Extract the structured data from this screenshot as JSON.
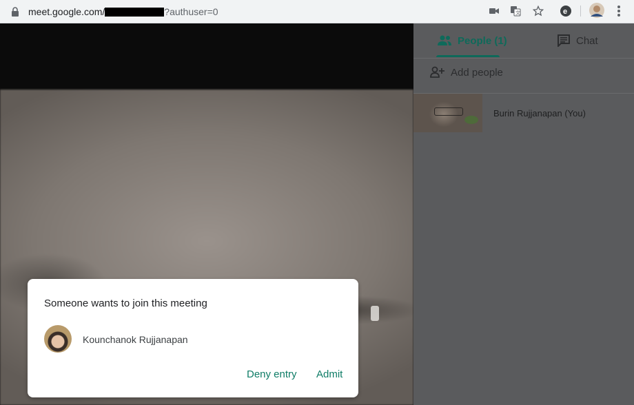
{
  "browser": {
    "url_domain": "meet.google.com/",
    "url_suffix": "?authuser=0",
    "icons": [
      "lock-icon",
      "video-camera-icon",
      "translate-icon",
      "star-icon",
      "extension-icon",
      "profile-avatar",
      "menu-icon"
    ]
  },
  "panel": {
    "tabs": [
      {
        "label": "People (1)",
        "icon": "people-icon",
        "active": true
      },
      {
        "label": "Chat",
        "icon": "chat-icon",
        "active": false
      }
    ],
    "add_people_label": "Add people",
    "participants": [
      {
        "name": "Burin Rujjanapan (You)"
      }
    ]
  },
  "dialog": {
    "title": "Someone wants to join this meeting",
    "requester_name": "Kounchanok Rujjanapan",
    "deny_label": "Deny entry",
    "admit_label": "Admit"
  },
  "colors": {
    "accent": "#0e6a5a",
    "button_text": "#0e7c66",
    "panel_bg": "#5a5b5d"
  }
}
